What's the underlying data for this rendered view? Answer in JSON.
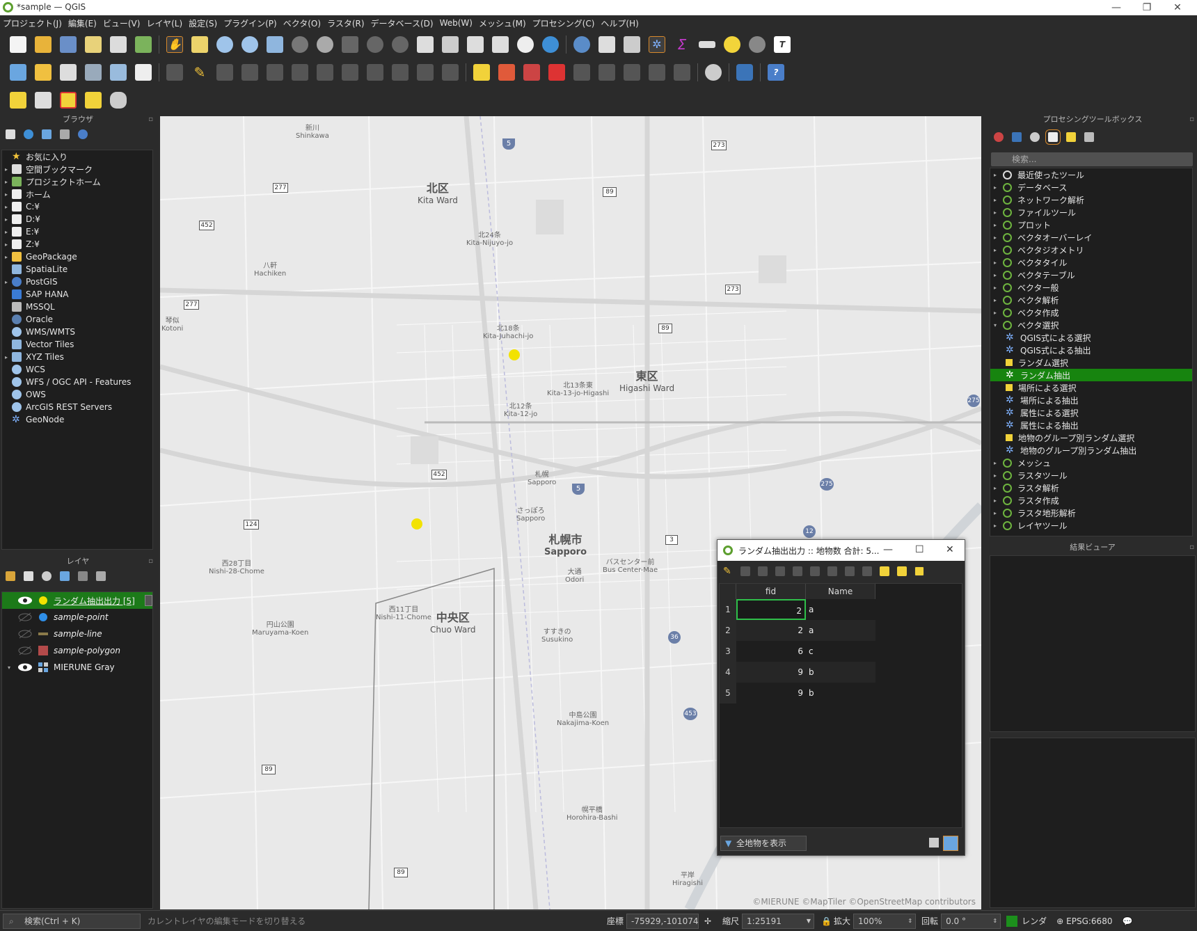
{
  "window": {
    "title": "*sample — QGIS",
    "minimize": "—",
    "maximize": "❐",
    "close": "✕"
  },
  "menu": [
    "プロジェクト(J)",
    "編集(E)",
    "ビュー(V)",
    "レイヤ(L)",
    "設定(S)",
    "プラグイン(P)",
    "ベクタ(O)",
    "ラスタ(R)",
    "データベース(D)",
    "Web(W)",
    "メッシュ(M)",
    "プロセシング(C)",
    "ヘルプ(H)"
  ],
  "browser": {
    "title": "ブラウザ",
    "items": [
      "お気に入り",
      "空間ブックマーク",
      "プロジェクトホーム",
      "ホーム",
      "C:¥",
      "D:¥",
      "E:¥",
      "Z:¥",
      "GeoPackage",
      "SpatiaLite",
      "PostGIS",
      "SAP HANA",
      "MSSQL",
      "Oracle",
      "WMS/WMTS",
      "Vector Tiles",
      "XYZ Tiles",
      "WCS",
      "WFS / OGC API - Features",
      "OWS",
      "ArcGIS REST Servers",
      "GeoNode"
    ]
  },
  "layers": {
    "title": "レイヤ",
    "items": [
      {
        "name": "ランダム抽出出力 [5]",
        "color": "#f2e200"
      },
      {
        "name": "sample-point",
        "color": "#2f8fe8"
      },
      {
        "name": "sample-line",
        "color": "#8a7a4a"
      },
      {
        "name": "sample-polygon",
        "color": "#b34a4a"
      },
      {
        "name": "MIERUNE Gray",
        "color": "#cccccc"
      }
    ]
  },
  "processing": {
    "title": "プロセシングツールボックス",
    "search_placeholder": "検索...",
    "groups_top": [
      "最近使ったツール",
      "データベース",
      "ネットワーク解析",
      "ファイルツール",
      "プロット",
      "ベクタオーバーレイ",
      "ベクタジオメトリ",
      "ベクタタイル",
      "ベクタテーブル",
      "ベクター般",
      "ベクタ解析",
      "ベクタ作成",
      "ベクタ選択"
    ],
    "tools": [
      "QGIS式による選択",
      "QGIS式による抽出",
      "ランダム選択",
      "ランダム抽出",
      "場所による選択",
      "場所による抽出",
      "属性による選択",
      "属性による抽出",
      "地物のグループ別ランダム選択",
      "地物のグループ別ランダム抽出"
    ],
    "groups_bottom": [
      "メッシュ",
      "ラスタツール",
      "ラスタ解析",
      "ラスタ作成",
      "ラスタ地形解析",
      "レイヤツール"
    ]
  },
  "results": {
    "title": "結果ビューア"
  },
  "map": {
    "labels": [
      {
        "t": "北区",
        "s": "Kita Ward"
      },
      {
        "t": "東区",
        "s": "Higashi Ward"
      },
      {
        "t": "中央区",
        "s": "Chuo Ward"
      },
      {
        "t": "札幌市",
        "s": "Sapporo"
      }
    ],
    "small_labels": [
      "北24条",
      "Kita-Nijuyo-jo",
      "北18条",
      "Kita-Juhachi-jo",
      "北12条",
      "Kita-12-jo",
      "北13条東",
      "Kita-13-jo-Higashi",
      "さっぽろ",
      "Sapporo",
      "大通",
      "Odori",
      "すすきの",
      "Susukino",
      "西28丁目",
      "Nishi-28-Chome",
      "円山公園",
      "Maruyama-Koen",
      "中島公園",
      "Nakajima-Koen",
      "幌平橋",
      "Horohira-Bashi",
      "バスセンター前",
      "Bus Center-Mae",
      "八軒",
      "Hachiken",
      "新川",
      "Shinkawa",
      "平岸",
      "Hiragishi",
      "札幌",
      "Sapporo",
      "西11丁目",
      "Nishi-11-Chome",
      "琴似",
      "Kotoni"
    ],
    "attribution": "©MIERUNE ©MapTiler ©OpenStreetMap contributors",
    "shields": [
      "5",
      "277",
      "452",
      "89",
      "273",
      "89",
      "273",
      "275",
      "452",
      "5",
      "124",
      "275",
      "12",
      "3",
      "36",
      "453",
      "89",
      "89",
      "277"
    ]
  },
  "attribute_table": {
    "title": "ランダム抽出出力 :: 地物数 合計: 5...",
    "columns": [
      "fid",
      "Name"
    ],
    "rows": [
      {
        "n": "1",
        "fid": "2",
        "name": "a"
      },
      {
        "n": "2",
        "fid": "2",
        "name": "a"
      },
      {
        "n": "3",
        "fid": "6",
        "name": "c"
      },
      {
        "n": "4",
        "fid": "9",
        "name": "b"
      },
      {
        "n": "5",
        "fid": "9",
        "name": "b"
      }
    ],
    "filter_button": "全地物を表示"
  },
  "status": {
    "locator_placeholder": "検索(Ctrl + K)",
    "message": "カレントレイヤの編集モードを切り替える",
    "coord_label": "座標",
    "coord_value": "-75929,-101074",
    "scale_label": "縮尺",
    "scale_value": "1:25191",
    "magnifier_label": "拡大",
    "magnifier_value": "100%",
    "rotation_label": "回転",
    "rotation_value": "0.0 °",
    "render_label": "レンダ",
    "crs": "EPSG:6680"
  }
}
